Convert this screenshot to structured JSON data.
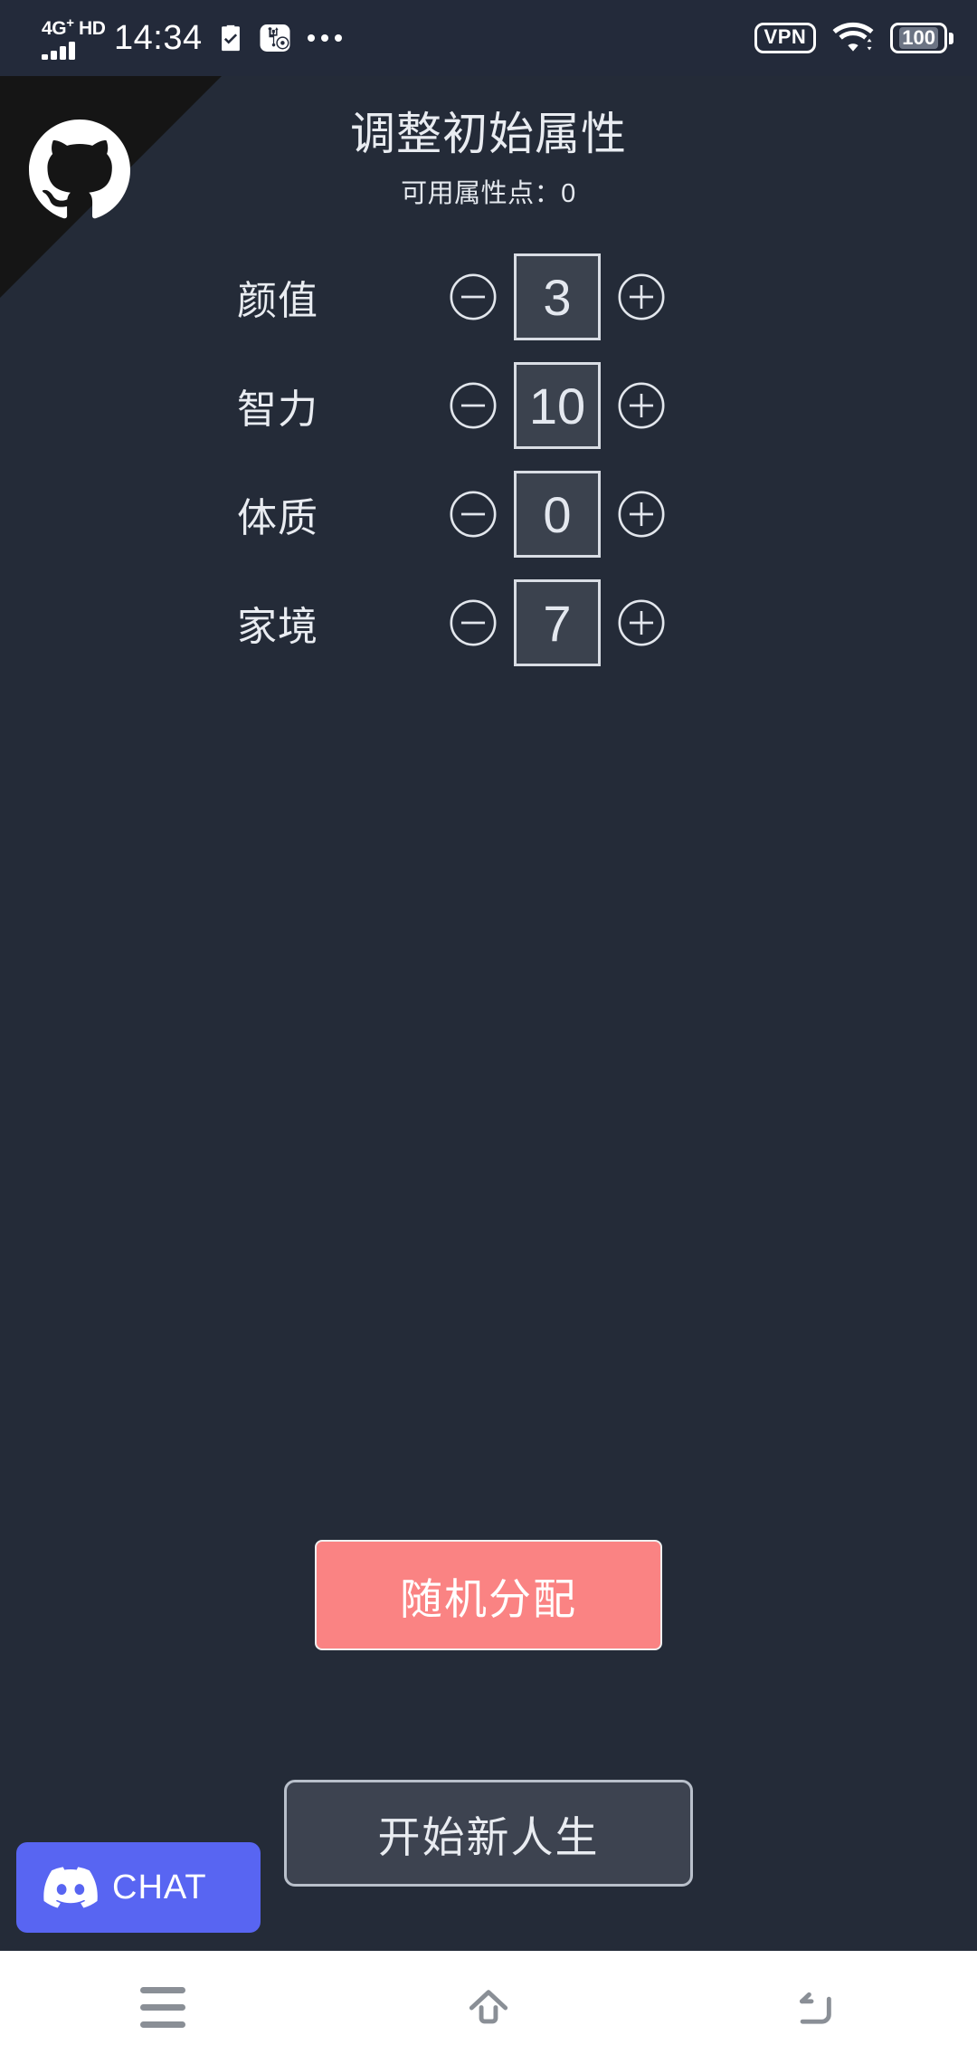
{
  "status_bar": {
    "network_type": "4G",
    "network_plus": "+",
    "network_hd": "HD",
    "time": "14:34",
    "task_icon": "clipboard-check-icon",
    "usb_icon": "usb-debug-icon",
    "more_icon": "more-dots-icon",
    "vpn_label": "VPN",
    "wifi_icon": "wifi-icon",
    "battery_level": "100"
  },
  "ribbon": {
    "icon": "github-octocat-icon"
  },
  "header": {
    "title": "调整初始属性",
    "subtitle": "可用属性点：0"
  },
  "attributes": {
    "minus_icon": "circle-minus-icon",
    "plus_icon": "circle-plus-icon",
    "rows": [
      {
        "label": "颜值",
        "value": "3"
      },
      {
        "label": "智力",
        "value": "10"
      },
      {
        "label": "体质",
        "value": "0"
      },
      {
        "label": "家境",
        "value": "7"
      }
    ]
  },
  "actions": {
    "random_label": "随机分配",
    "start_label": "开始新人生"
  },
  "discord": {
    "label": "CHAT",
    "icon": "discord-logo-icon"
  },
  "nav_bar": {
    "recents": "recents-icon",
    "home": "home-icon",
    "back": "back-icon"
  },
  "colors": {
    "page_bg": "#242b38",
    "status_bar_bg": "#232a3a",
    "ribbon_bg": "#151515",
    "text_primary": "#e9ecf1",
    "value_box_bg": "#3b424e",
    "value_box_border": "#d9dde4",
    "random_btn_bg": "#fa8383",
    "start_btn_bg": "#3d4350",
    "discord_bg": "#5865f2",
    "nav_bar_bg": "#ffffff"
  }
}
